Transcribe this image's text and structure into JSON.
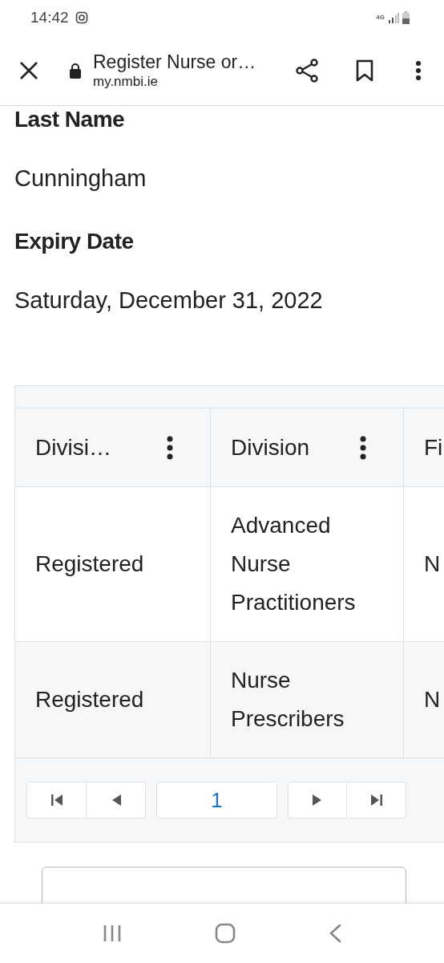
{
  "status_bar": {
    "time": "14:42",
    "network": "4G"
  },
  "browser_bar": {
    "title": "Register Nurse or…",
    "url": "my.nmbi.ie"
  },
  "fields": [
    {
      "label": "Last Name",
      "value": "Cunningham"
    },
    {
      "label": "Expiry Date",
      "value": "Saturday, December 31, 2022"
    }
  ],
  "table": {
    "columns": [
      {
        "label": "Divisi…",
        "menu": true
      },
      {
        "label": "Division",
        "menu": true
      },
      {
        "label": "Fi"
      }
    ],
    "rows": [
      {
        "cells": [
          "Registered",
          "Advanced Nurse Practitioners",
          "N"
        ]
      },
      {
        "cells": [
          "Registered",
          "Nurse Prescribers",
          "N"
        ]
      }
    ],
    "pager": {
      "page": "1"
    }
  }
}
